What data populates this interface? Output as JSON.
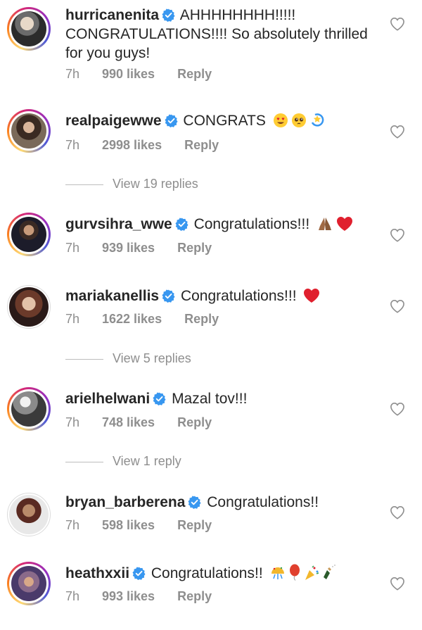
{
  "colors": {
    "verified": "#3897f0",
    "muted": "#8e8e8e",
    "text": "#262626",
    "heart_emoji": "#e0202e"
  },
  "comments": [
    {
      "username": "hurricanenita",
      "verified": true,
      "text": "AHHHHHHHH!!!!! CONGRATULATIONS!!!! So absolutely thrilled for you guys!",
      "time": "7h",
      "likes": "990 likes",
      "reply": "Reply"
    },
    {
      "username": "realpaigewwe",
      "verified": true,
      "text": "CONGRATS",
      "emojis": [
        "heart-eyes-emoji",
        "pleading-face-emoji",
        "dizzy-emoji"
      ],
      "time": "7h",
      "likes": "2998 likes",
      "reply": "Reply",
      "view_replies": "View 19 replies"
    },
    {
      "username": "gurvsihra_wwe",
      "verified": true,
      "text": "Congratulations!!!",
      "emojis": [
        "folded-hands-emoji",
        "red-heart-emoji"
      ],
      "time": "7h",
      "likes": "939 likes",
      "reply": "Reply"
    },
    {
      "username": "mariakanellis",
      "verified": true,
      "text": "Congratulations!!!",
      "emojis": [
        "red-heart-emoji"
      ],
      "time": "7h",
      "likes": "1622 likes",
      "reply": "Reply",
      "view_replies": "View 5 replies"
    },
    {
      "username": "arielhelwani",
      "verified": true,
      "text": "Mazal tov!!!",
      "time": "7h",
      "likes": "748 likes",
      "reply": "Reply",
      "view_replies": "View 1 reply"
    },
    {
      "username": "bryan_barberena",
      "verified": true,
      "text": "Congratulations!!",
      "time": "7h",
      "likes": "598 likes",
      "reply": "Reply"
    },
    {
      "username": "heathxxii",
      "verified": true,
      "text": "Congratulations!!",
      "emojis": [
        "confetti-ball-emoji",
        "balloon-emoji",
        "party-popper-emoji",
        "bottle-with-popping-cork-emoji"
      ],
      "time": "7h",
      "likes": "993 likes",
      "reply": "Reply"
    }
  ]
}
